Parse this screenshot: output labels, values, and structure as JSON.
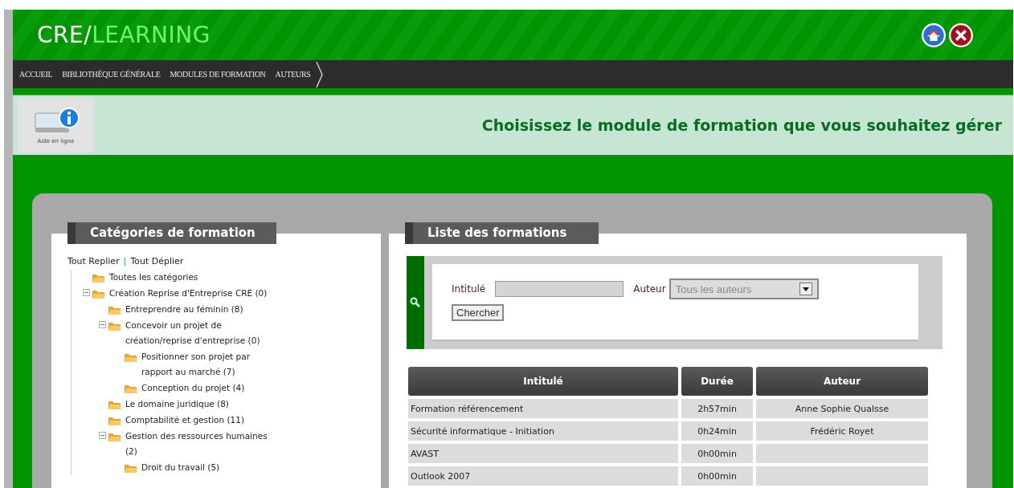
{
  "logo": {
    "first": "CRE/",
    "second": "LEARNING"
  },
  "nav": [
    "ACCUEIL",
    "BIBLIOTHÈQUE GÉNÉRALE",
    "MODULES DE FORMATION",
    "AUTEURS"
  ],
  "help": {
    "label": "Aide en ligne"
  },
  "heading": "Choisissez le module de formation que vous souhaitez gérer",
  "categories": {
    "title": "Catégories de formation",
    "collapse_all": "Tout Replier",
    "separator": "|",
    "expand_all": "Tout Déplier",
    "tree": [
      {
        "label": "Toutes les catégories"
      },
      {
        "label": "Création Reprise d'Entreprise CRE (0)",
        "expanded": true,
        "children": [
          {
            "label": "Entreprendre au féminin (8)"
          },
          {
            "label": "Concevoir un projet de création/reprise d'entreprise (0)",
            "expanded": true,
            "children": [
              {
                "label": "Positionner son projet par rapport au marché (7)"
              },
              {
                "label": "Conception du projet (4)"
              }
            ]
          },
          {
            "label": "Le domaine juridique (8)"
          },
          {
            "label": "Comptabilité et gestion (11)"
          },
          {
            "label": "Gestion des ressources humaines (2)",
            "expanded": true,
            "children": [
              {
                "label": "Droit du travail (5)"
              }
            ]
          }
        ]
      }
    ]
  },
  "formations": {
    "title": "Liste des formations",
    "search": {
      "title_label": "Intitulé",
      "author_label": "Auteur",
      "author_value": "Tous les auteurs",
      "button": "Chercher"
    },
    "table": {
      "columns": [
        "Intitulé",
        "Durée",
        "Auteur"
      ],
      "rows": [
        [
          "Formation référencement",
          "2h57min",
          "Anne Sophie Qualsse"
        ],
        [
          "Sécurité informatique - Initiation",
          "0h24min",
          "Frédéric Royet"
        ],
        [
          "AVAST",
          "0h00min",
          ""
        ],
        [
          "Outlook 2007",
          "0h00min",
          ""
        ]
      ]
    }
  }
}
